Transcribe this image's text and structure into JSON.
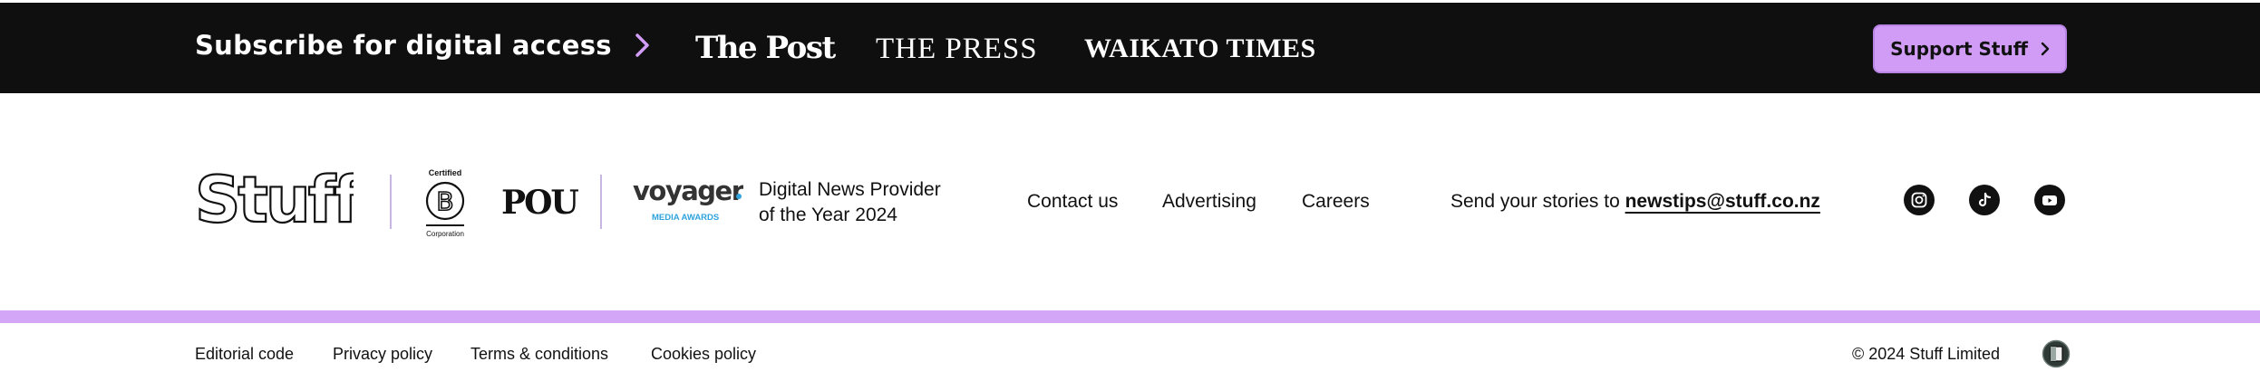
{
  "topbar": {
    "subscribe_label": "Subscribe for digital access",
    "mastheads": [
      "The Post",
      "THE PRESS",
      "WAIKATO TIMES"
    ],
    "support_label": "Support Stuff"
  },
  "brand": {
    "logo": "Stuff",
    "bcorp_top": "Certified",
    "bcorp_bottom": "Corporation",
    "pou": "POU",
    "voyager": "voyager",
    "voyager_sub": "MEDIA AWARDS",
    "award_line1": "Digital News Provider",
    "award_line2": "of the Year 2024"
  },
  "nav": {
    "contact": "Contact us",
    "advertising": "Advertising",
    "careers": "Careers"
  },
  "stories": {
    "prefix": "Send your stories to",
    "email": "newstips@stuff.co.nz"
  },
  "social": {
    "icons": [
      "instagram-icon",
      "tiktok-icon",
      "youtube-icon"
    ]
  },
  "footer": {
    "links": [
      "Editorial code",
      "Privacy policy",
      "Terms & conditions",
      "Cookies policy"
    ],
    "copyright": "© 2024 Stuff Limited"
  },
  "colors": {
    "topbar_bg": "#0f0f0f",
    "accent": "#d09cf5",
    "strip": "#d3a6f7",
    "voyager_blue": "#2ea3dd"
  }
}
